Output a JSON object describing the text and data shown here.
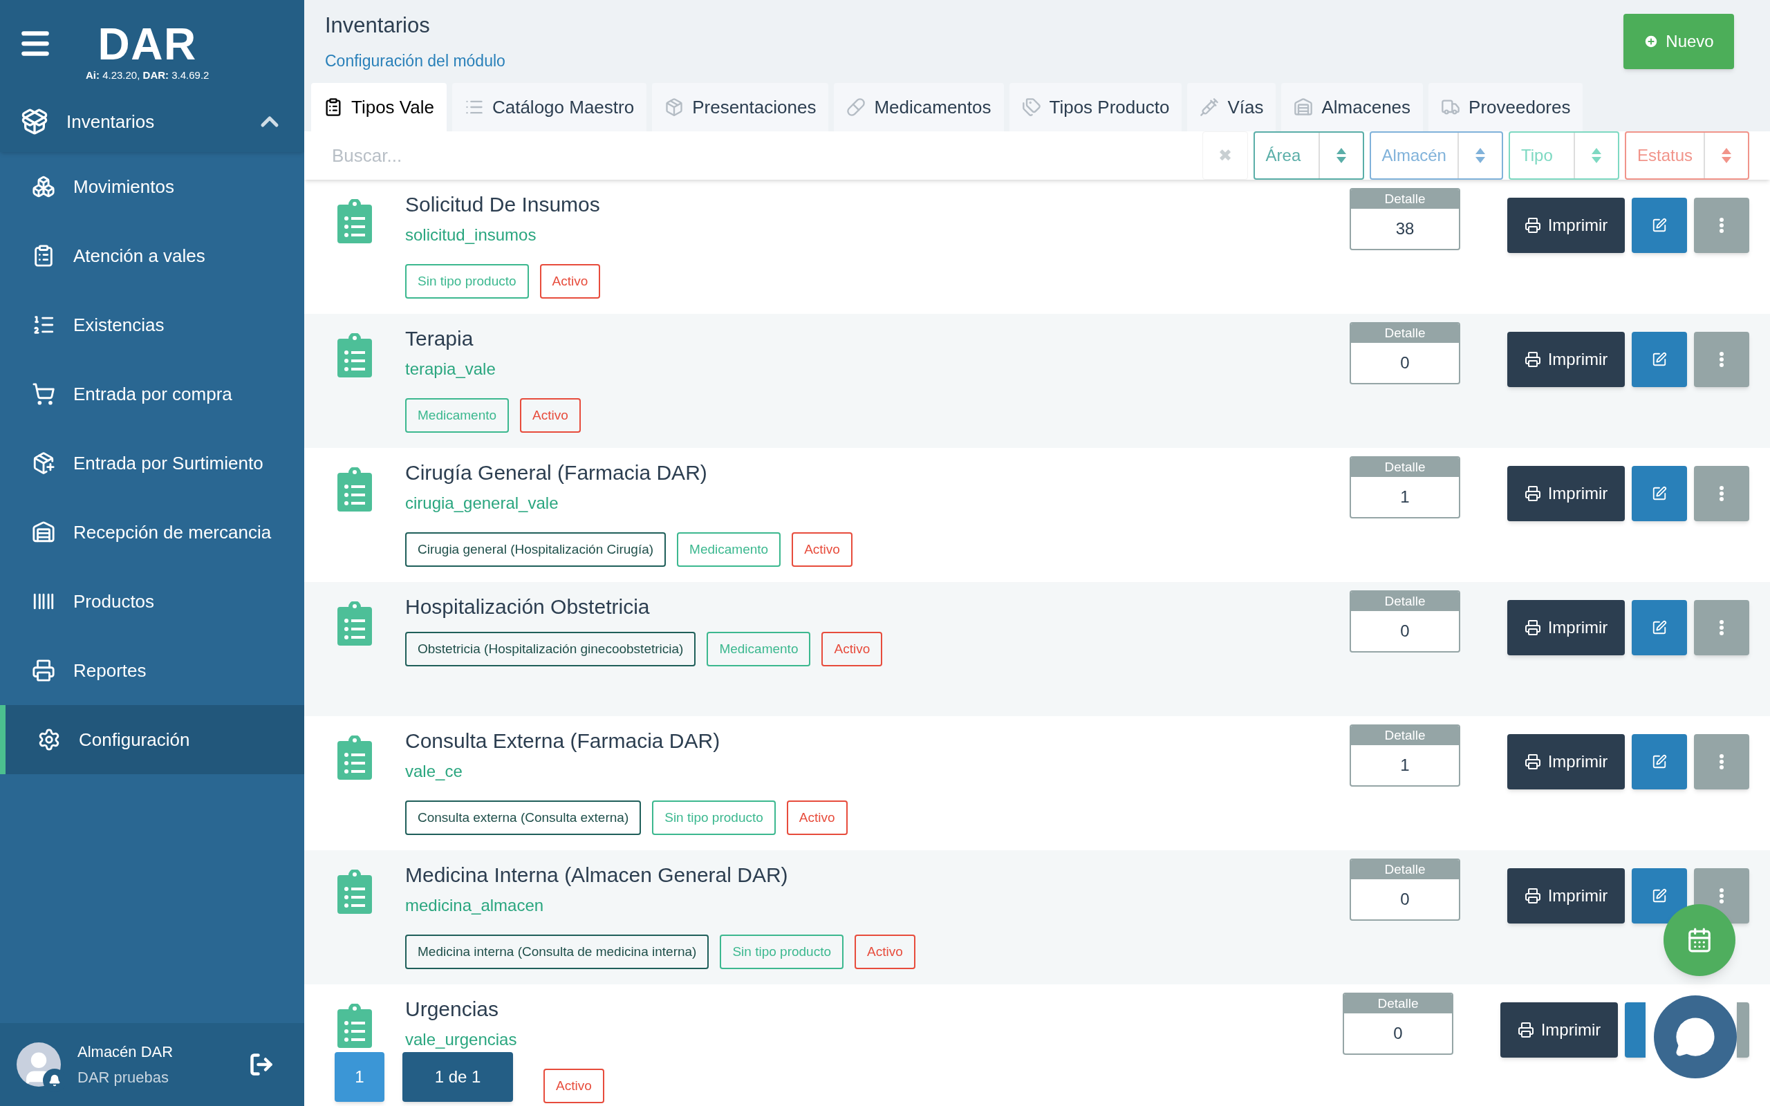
{
  "sidebar": {
    "logo": "DAR",
    "version": "**Ai:** 4.23.20, **DAR:** 3.4.69.2",
    "section": {
      "label": "Inventarios",
      "expanded": true
    },
    "items": [
      {
        "label": "Movimientos",
        "selected": false
      },
      {
        "label": "Atención a vales",
        "selected": false
      },
      {
        "label": "Existencias",
        "selected": false
      },
      {
        "label": "Entrada por compra",
        "selected": false
      },
      {
        "label": "Entrada por Surtimiento",
        "selected": false
      },
      {
        "label": "Recepción de mercancia",
        "selected": false
      },
      {
        "label": "Productos",
        "selected": false
      },
      {
        "label": "Reportes",
        "selected": false
      },
      {
        "label": "Configuración",
        "selected": true
      }
    ],
    "user": {
      "name": "Almacén DAR",
      "subtitle": "DAR pruebas"
    }
  },
  "header": {
    "title": "Inventarios",
    "subtitle": "Configuración del módulo",
    "new_button": "Nuevo"
  },
  "tabs": [
    {
      "label": "Tipos Vale",
      "selected": true
    },
    {
      "label": "Catálogo Maestro",
      "selected": false
    },
    {
      "label": "Presentaciones",
      "selected": false
    },
    {
      "label": "Medicamentos",
      "selected": false
    },
    {
      "label": "Tipos Producto",
      "selected": false
    },
    {
      "label": "Vías",
      "selected": false
    },
    {
      "label": "Almacenes",
      "selected": false
    },
    {
      "label": "Proveedores",
      "selected": false
    }
  ],
  "filters": {
    "search_placeholder": "Buscar...",
    "clear": "✖",
    "selects": [
      {
        "label": "Área",
        "color": "#5aaea8"
      },
      {
        "label": "Almacén",
        "color": "#80b2da"
      },
      {
        "label": "Tipo",
        "color": "#7ed9c2"
      },
      {
        "label": "Estatus",
        "color": "#f1948a"
      }
    ]
  },
  "rows": [
    {
      "title": "Solicitud De Insumos",
      "code": "solicitud_insumos",
      "tags": [
        {
          "label": "Sin tipo producto",
          "kind": "tipo"
        },
        {
          "label": "Activo",
          "kind": "estatus"
        }
      ],
      "detail_label": "Detalle",
      "detail_value": "38",
      "print": "Imprimir"
    },
    {
      "title": "Terapia",
      "code": "terapia_vale",
      "tags": [
        {
          "label": "Medicamento",
          "kind": "tipo"
        },
        {
          "label": "Activo",
          "kind": "estatus"
        }
      ],
      "detail_label": "Detalle",
      "detail_value": "0",
      "print": "Imprimir"
    },
    {
      "title": "Cirugía General (Farmacia DAR)",
      "code": "cirugia_general_vale",
      "tags": [
        {
          "label": "Cirugia general (Hospitalización Cirugía)",
          "kind": "area"
        },
        {
          "label": "Medicamento",
          "kind": "tipo"
        },
        {
          "label": "Activo",
          "kind": "estatus"
        }
      ],
      "detail_label": "Detalle",
      "detail_value": "1",
      "print": "Imprimir"
    },
    {
      "title": "Hospitalización Obstetricia",
      "tags": [
        {
          "label": "Obstetricia (Hospitalización ginecoobstetricia)",
          "kind": "area"
        },
        {
          "label": "Medicamento",
          "kind": "tipo"
        },
        {
          "label": "Activo",
          "kind": "estatus"
        }
      ],
      "detail_label": "Detalle",
      "detail_value": "0",
      "print": "Imprimir"
    },
    {
      "title": "Consulta Externa (Farmacia DAR)",
      "code": "vale_ce",
      "tags": [
        {
          "label": "Consulta externa (Consulta externa)",
          "kind": "area"
        },
        {
          "label": "Sin tipo producto",
          "kind": "tipo"
        },
        {
          "label": "Activo",
          "kind": "estatus"
        }
      ],
      "detail_label": "Detalle",
      "detail_value": "1",
      "print": "Imprimir"
    },
    {
      "title": "Medicina Interna (Almacen General DAR)",
      "code": "medicina_almacen",
      "tags": [
        {
          "label": "Medicina interna (Consulta de medicina interna)",
          "kind": "area"
        },
        {
          "label": "Sin tipo producto",
          "kind": "tipo"
        },
        {
          "label": "Activo",
          "kind": "estatus"
        }
      ],
      "detail_label": "Detalle",
      "detail_value": "0",
      "print": "Imprimir"
    },
    {
      "title": "Urgencias",
      "code": "vale_urgencias",
      "tags": [
        {
          "label": "Activo",
          "kind": "estatus"
        }
      ],
      "detail_label": "Detalle",
      "detail_value": "0",
      "print": "Imprimir"
    }
  ],
  "pagination": {
    "page": "1",
    "summary": "1 de 1"
  }
}
